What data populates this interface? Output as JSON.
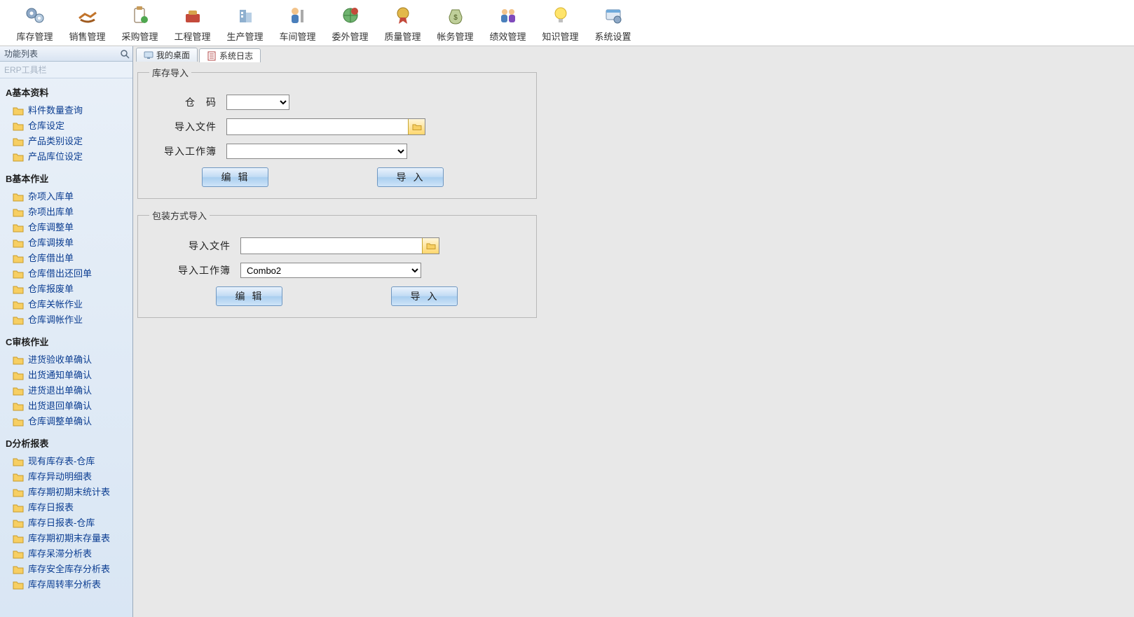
{
  "toolbar": {
    "items": [
      {
        "label": "库存管理",
        "icon": "gears"
      },
      {
        "label": "销售管理",
        "icon": "handshake"
      },
      {
        "label": "采购管理",
        "icon": "clipboard"
      },
      {
        "label": "工程管理",
        "icon": "toolbox"
      },
      {
        "label": "生产管理",
        "icon": "building"
      },
      {
        "label": "车间管理",
        "icon": "worker"
      },
      {
        "label": "委外管理",
        "icon": "globe"
      },
      {
        "label": "质量管理",
        "icon": "badge"
      },
      {
        "label": "帐务管理",
        "icon": "moneybag"
      },
      {
        "label": "绩效管理",
        "icon": "people"
      },
      {
        "label": "知识管理",
        "icon": "bulb"
      },
      {
        "label": "系统设置",
        "icon": "settings"
      }
    ]
  },
  "sidebar": {
    "header": "功能列表",
    "erp_label": "ERP工具栏",
    "groups": [
      {
        "title": "A基本资料",
        "items": [
          "料件数量查询",
          "仓库设定",
          "产品类别设定",
          "产品库位设定"
        ]
      },
      {
        "title": "B基本作业",
        "items": [
          "杂项入库单",
          "杂项出库单",
          "仓库调整单",
          "仓库调拨单",
          "仓库借出单",
          "仓库借出还回单",
          "仓库报废单",
          "仓库关帐作业",
          "仓库调帐作业"
        ]
      },
      {
        "title": "C审核作业",
        "items": [
          "进货验收单确认",
          "出货通知单确认",
          "进货退出单确认",
          "出货退回单确认",
          "仓库调整单确认"
        ]
      },
      {
        "title": "D分析报表",
        "items": [
          "现有库存表-仓库",
          "库存异动明细表",
          "库存期初期末统计表",
          "库存日报表",
          "库存日报表-仓库",
          "库存期初期末存量表",
          "库存呆滞分析表",
          "库存安全库存分析表",
          "库存周转率分析表"
        ]
      }
    ]
  },
  "tabs": {
    "inactive": "我的桌面",
    "active": "系统日志"
  },
  "group_inventory": {
    "legend": "库存导入",
    "lbl_cangma": "仓　码",
    "lbl_file": "导入文件",
    "lbl_wb": "导入工作簿",
    "combo_cangma": "",
    "file_value": "",
    "wb_value": ""
  },
  "group_package": {
    "legend": "包装方式导入",
    "lbl_file": "导入文件",
    "lbl_wb": "导入工作簿",
    "file_value": "",
    "wb_value": "Combo2"
  },
  "buttons": {
    "edit": "编辑",
    "import": "导入"
  }
}
